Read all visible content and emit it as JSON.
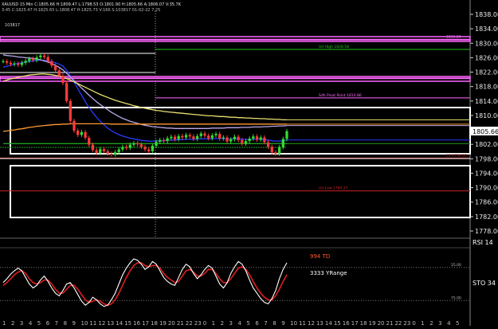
{
  "header": {
    "line1": "XAUUSD  15 Min  C:1805.66  H:1809.47  L:1798.53  O:1801.90  H:1805.66  A:1806.07  V:35.7K",
    "line2": "3:45  C:1825.47  H:1825.65  L:1808.47  H:1825.73  V:166  S:103817  01-02-22  7:25",
    "tag": "103817"
  },
  "price_axis": {
    "ticks": [
      1838.0,
      1834.0,
      1830.0,
      1826.0,
      1822.0,
      1818.0,
      1814.0,
      1810.0,
      1805.66,
      1802.0,
      1798.0,
      1794.0,
      1790.0,
      1786.0,
      1782.0,
      1778.0
    ],
    "current_price": "1805.66"
  },
  "levels": [
    {
      "id": "magenta-top",
      "price": 1831.0,
      "color": "#ff66ff",
      "label": "1831.50",
      "label_color": "#ff66ff"
    },
    {
      "id": "ud-high",
      "price": 1828.3,
      "color": "#22cc22",
      "label": "Ud High 1828.58",
      "label_color": "#22cc22"
    },
    {
      "id": "magenta-mid",
      "price": 1820.3,
      "color": "#ff66ff",
      "label": "",
      "label_color": "#ff66ff"
    },
    {
      "id": "pivot",
      "price": 1814.86,
      "color": "#ff66ff",
      "label": "Sdh Pivot Point 1814.86",
      "label_color": "#ff66ff"
    },
    {
      "id": "s1",
      "price": 1798.2,
      "color": "#cc2222",
      "label": "S1 1798.20",
      "label_color": "#cc2222"
    },
    {
      "id": "ud-low",
      "price": 1789.1,
      "color": "#cc2222",
      "label": "Ud Low 1789.27",
      "label_color": "#cc2222"
    }
  ],
  "right_labels": {
    "rsi": "RSI 14",
    "sto": "STO 34"
  },
  "indicator_labels": {
    "td": "994 TD",
    "yrange": "3333 YRange"
  },
  "time_axis": {
    "labels": [
      "1",
      "2",
      "3",
      "4",
      "5",
      "6",
      "7",
      "8",
      "9",
      "10",
      "11",
      "12",
      "13",
      "14",
      "15",
      "16",
      "17",
      "18",
      "19",
      "20",
      "21",
      "22",
      "23",
      "0",
      "1",
      "2",
      "3",
      "4",
      "5",
      "6",
      "7",
      "8",
      "9",
      "10",
      "11",
      "12",
      "13",
      "14",
      "15",
      "16",
      "17",
      "18",
      "19",
      "20",
      "21",
      "22",
      "23",
      "0",
      "1",
      "2",
      "3",
      "4",
      "5"
    ]
  },
  "chart_data": {
    "type": "candlestick",
    "symbol": "XAUUSD",
    "interval": "15 Min",
    "price_ylim": [
      1776,
      1840
    ],
    "closes": [
      1825.0,
      1824.6,
      1824.2,
      1824.4,
      1824.0,
      1824.6,
      1825.1,
      1825.7,
      1825.3,
      1826.1,
      1826.6,
      1826.2,
      1825.0,
      1823.8,
      1822.5,
      1821.0,
      1819.0,
      1814.0,
      1808.5,
      1805.8,
      1804.6,
      1805.4,
      1803.8,
      1801.9,
      1800.4,
      1799.6,
      1800.7,
      1800.1,
      1799.4,
      1799.2,
      1799.8,
      1800.6,
      1801.3,
      1801.0,
      1801.9,
      1802.3,
      1802.0,
      1801.3,
      1800.6,
      1800.1,
      1801.6,
      1802.7,
      1803.2,
      1802.9,
      1803.7,
      1804.1,
      1803.4,
      1804.3,
      1803.9,
      1804.6,
      1804.2,
      1803.5,
      1804.3,
      1805.0,
      1804.4,
      1803.7,
      1804.5,
      1804.9,
      1803.6,
      1803.9,
      1802.8,
      1803.4,
      1804.1,
      1803.2,
      1802.2,
      1802.9,
      1803.6,
      1804.2,
      1803.3,
      1803.9,
      1802.6,
      1801.3,
      1799.8,
      1799.4,
      1801.2,
      1803.5,
      1805.66
    ],
    "series": [
      {
        "name": "blue",
        "color": "#2a3cff",
        "values": [
          1823.4,
          1823.6,
          1823.9,
          1824.2,
          1824.4,
          1824.6,
          1824.8,
          1825.0,
          1825.1,
          1825.2,
          1825.4,
          1825.3,
          1825.1,
          1824.9,
          1824.6,
          1824.2,
          1823.7,
          1822.5,
          1821.0,
          1819.2,
          1817.4,
          1815.6,
          1813.8,
          1812.2,
          1810.8,
          1809.5,
          1808.4,
          1807.4,
          1806.5,
          1805.8,
          1805.2,
          1804.7,
          1804.3,
          1804.0,
          1803.7,
          1803.5,
          1803.3,
          1803.1,
          1803.0,
          1802.9,
          1802.9,
          1802.9,
          1803.0,
          1803.0,
          1803.1,
          1803.2,
          1803.2,
          1803.3,
          1803.3,
          1803.4,
          1803.4,
          1803.4,
          1803.5,
          1803.5,
          1803.5,
          1803.5,
          1803.5,
          1803.6,
          1803.6,
          1803.6,
          1803.5,
          1803.5,
          1803.5,
          1803.5,
          1803.4,
          1803.4,
          1803.4,
          1803.4,
          1803.4,
          1803.4,
          1803.3,
          1803.2,
          1803.0,
          1802.9,
          1802.9,
          1803.0,
          1803.2
        ]
      },
      {
        "name": "lavender",
        "color": "#b8a8e8",
        "values": [
          1826.8,
          1826.6,
          1826.5,
          1826.4,
          1826.2,
          1826.1,
          1826.0,
          1825.9,
          1825.8,
          1825.6,
          1825.4,
          1825.1,
          1824.8,
          1824.4,
          1823.9,
          1823.3,
          1822.6,
          1821.7,
          1820.7,
          1819.6,
          1818.6,
          1817.6,
          1816.6,
          1815.6,
          1814.7,
          1813.8,
          1813.0,
          1812.3,
          1811.6,
          1810.9,
          1810.3,
          1809.7,
          1809.2,
          1808.8,
          1808.4,
          1808.1,
          1807.8,
          1807.5,
          1807.3,
          1807.1,
          1806.9,
          1806.8,
          1806.7,
          1806.6,
          1806.5,
          1806.5,
          1806.4,
          1806.4,
          1806.4,
          1806.4,
          1806.4,
          1806.4,
          1806.4,
          1806.4,
          1806.4,
          1806.4,
          1806.5,
          1806.5,
          1806.5,
          1806.5,
          1806.6,
          1806.6,
          1806.6,
          1806.6,
          1806.7,
          1806.7,
          1806.7,
          1806.8,
          1806.8,
          1806.8,
          1806.9,
          1806.9,
          1807.0,
          1807.0,
          1807.1,
          1807.1,
          1807.2
        ]
      },
      {
        "name": "yellow",
        "color": "#e8e070",
        "values": [
          1819.5,
          1819.8,
          1820.1,
          1820.3,
          1820.6,
          1820.8,
          1821.0,
          1821.2,
          1821.3,
          1821.4,
          1821.5,
          1821.5,
          1821.4,
          1821.3,
          1821.1,
          1820.9,
          1820.6,
          1820.2,
          1819.8,
          1819.3,
          1818.8,
          1818.3,
          1817.8,
          1817.3,
          1816.8,
          1816.3,
          1815.8,
          1815.4,
          1815.0,
          1814.6,
          1814.2,
          1813.9,
          1813.6,
          1813.3,
          1813.0,
          1812.7,
          1812.5,
          1812.2,
          1812.0,
          1811.8,
          1811.6,
          1811.4,
          1811.3,
          1811.1,
          1811.0,
          1810.9,
          1810.8,
          1810.7,
          1810.6,
          1810.5,
          1810.4,
          1810.3,
          1810.2,
          1810.1,
          1810.0,
          1809.9,
          1809.9,
          1809.8,
          1809.7,
          1809.7,
          1809.6,
          1809.5,
          1809.5,
          1809.4,
          1809.4,
          1809.3,
          1809.3,
          1809.2,
          1809.2,
          1809.1,
          1809.1,
          1809.0,
          1809.0,
          1808.9,
          1808.9,
          1808.8,
          1808.8
        ]
      },
      {
        "name": "orange",
        "color": "#ff9a33",
        "values": [
          1805.6,
          1805.7,
          1805.9,
          1806.0,
          1806.2,
          1806.3,
          1806.5,
          1806.7,
          1806.8,
          1807.0,
          1807.1,
          1807.2,
          1807.3,
          1807.4,
          1807.5,
          1807.5,
          1807.6,
          1807.6,
          1807.7,
          1807.7,
          1807.7,
          1807.7,
          1807.7,
          1807.7,
          1807.7,
          1807.7,
          1807.7,
          1807.7,
          1807.7,
          1807.6,
          1807.6,
          1807.6,
          1807.6,
          1807.6,
          1807.6,
          1807.6,
          1807.6,
          1807.6,
          1807.6,
          1807.6,
          1807.6,
          1807.6,
          1807.6,
          1807.6,
          1807.6,
          1807.6,
          1807.6,
          1807.6,
          1807.6,
          1807.6,
          1807.6,
          1807.6,
          1807.6,
          1807.6,
          1807.6,
          1807.6,
          1807.6,
          1807.6,
          1807.6,
          1807.6,
          1807.6,
          1807.6,
          1807.6,
          1807.6,
          1807.6,
          1807.6,
          1807.6,
          1807.6,
          1807.6,
          1807.6,
          1807.6,
          1807.6,
          1807.6,
          1807.6,
          1807.6,
          1807.6,
          1807.6
        ]
      },
      {
        "name": "green",
        "color": "#20a020",
        "values": [
          1802.2,
          1802.2,
          1802.2,
          1802.2,
          1802.2,
          1802.2,
          1802.2,
          1802.2,
          1802.2,
          1802.2,
          1802.2,
          1802.2,
          1802.2,
          1802.2,
          1802.2,
          1802.2,
          1802.2,
          1802.2,
          1802.2,
          1802.2,
          1802.2,
          1802.2,
          1802.2,
          1802.2,
          1802.2,
          1802.2,
          1802.2,
          1802.2,
          1802.2,
          1802.2,
          1802.2,
          1802.2,
          1802.2,
          1802.2,
          1802.2,
          1802.2,
          1802.2,
          1802.2,
          1802.2,
          1802.2,
          1802.2,
          1802.2,
          1802.2,
          1802.2,
          1802.2,
          1802.2,
          1802.2,
          1802.2,
          1802.2,
          1802.2,
          1802.2,
          1802.2,
          1802.2,
          1802.2,
          1802.2,
          1802.2,
          1802.2,
          1802.2,
          1802.2,
          1802.2,
          1802.2,
          1802.2,
          1802.2,
          1802.2,
          1802.2,
          1802.2,
          1802.2,
          1802.2,
          1802.2,
          1802.2,
          1802.2,
          1802.2,
          1802.2,
          1802.2,
          1802.2,
          1802.2,
          1802.2
        ]
      }
    ],
    "rsi_white": [
      52,
      58,
      65,
      70,
      74,
      70,
      60,
      50,
      44,
      48,
      56,
      62,
      54,
      44,
      36,
      32,
      40,
      50,
      52,
      44,
      34,
      24,
      18,
      22,
      30,
      26,
      20,
      16,
      18,
      26,
      36,
      50,
      64,
      74,
      82,
      88,
      86,
      80,
      72,
      76,
      84,
      80,
      70,
      60,
      54,
      50,
      48,
      60,
      72,
      80,
      76,
      66,
      58,
      64,
      72,
      78,
      74,
      62,
      50,
      44,
      52,
      66,
      76,
      84,
      80,
      70,
      56,
      44,
      36,
      28,
      22,
      20,
      28,
      40,
      58,
      72,
      82
    ],
    "sto_red": [
      48,
      52,
      58,
      64,
      68,
      70,
      66,
      58,
      52,
      50,
      52,
      56,
      56,
      50,
      42,
      36,
      36,
      42,
      48,
      48,
      42,
      34,
      26,
      22,
      24,
      26,
      24,
      20,
      18,
      20,
      26,
      36,
      48,
      60,
      70,
      78,
      82,
      82,
      78,
      76,
      78,
      78,
      74,
      66,
      60,
      56,
      52,
      54,
      62,
      70,
      72,
      68,
      62,
      62,
      66,
      72,
      72,
      66,
      58,
      52,
      52,
      58,
      66,
      74,
      76,
      72,
      64,
      54,
      44,
      36,
      30,
      26,
      26,
      32,
      42,
      54,
      64
    ],
    "osc_levels": {
      "upper": "25.00",
      "lower": "75.00"
    }
  }
}
